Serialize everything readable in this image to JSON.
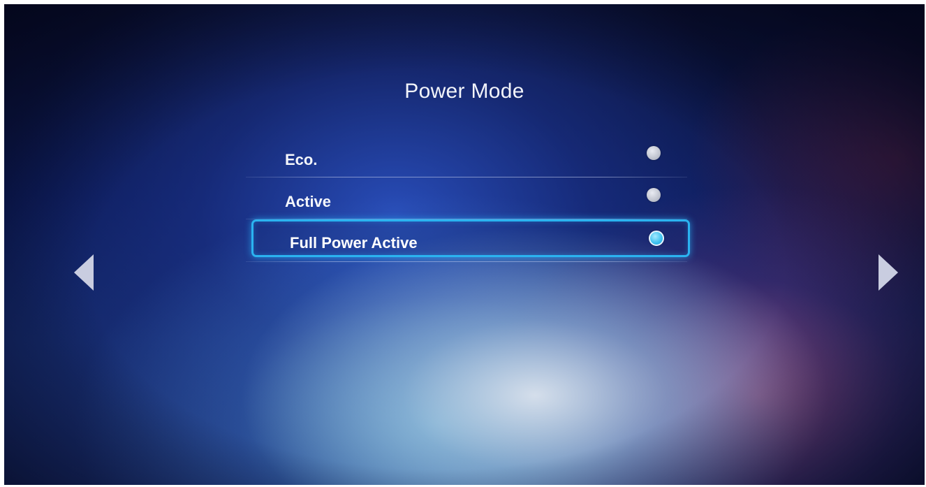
{
  "screen": {
    "title": "Power Mode"
  },
  "options": [
    {
      "label": "Eco.",
      "selected": false
    },
    {
      "label": "Active",
      "selected": false
    },
    {
      "label": "Full Power Active",
      "selected": true
    }
  ],
  "navigation": {
    "left_icon": "triangle-left-icon",
    "right_icon": "triangle-right-icon"
  },
  "colors": {
    "highlight": "#2bb3f0",
    "selected_radio": "#3bc0ee",
    "unselected_radio": "#c4c8d4"
  }
}
